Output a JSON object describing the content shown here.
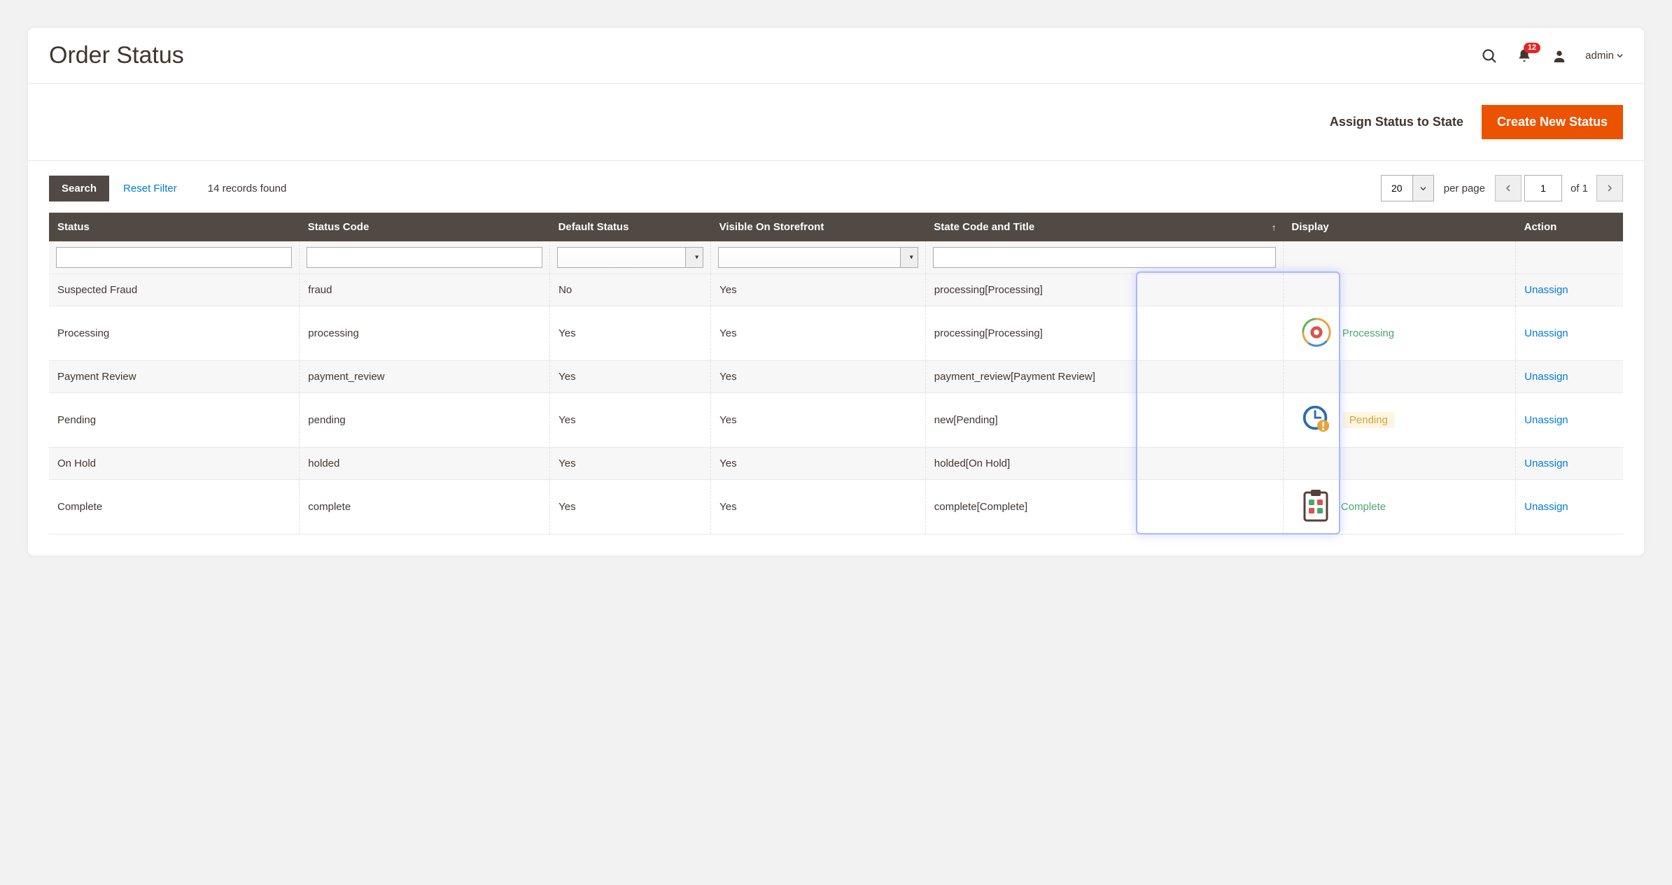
{
  "header": {
    "title": "Order Status",
    "notification_count": "12",
    "user_label": "admin"
  },
  "actionbar": {
    "assign_label": "Assign Status to State",
    "create_label": "Create New Status"
  },
  "toolbar": {
    "search_label": "Search",
    "reset_label": "Reset Filter",
    "records_found": "14 records found",
    "page_size": "20",
    "per_page_label": "per page",
    "page_current": "1",
    "page_of": "of 1"
  },
  "columns": {
    "status": "Status",
    "code": "Status Code",
    "default": "Default Status",
    "visible": "Visible On Storefront",
    "state": "State Code and Title",
    "display": "Display",
    "action": "Action"
  },
  "rows": [
    {
      "status": "Suspected Fraud",
      "code": "fraud",
      "default": "No",
      "visible": "Yes",
      "state": "processing[Processing]",
      "display": "",
      "action": "Unassign"
    },
    {
      "status": "Processing",
      "code": "processing",
      "default": "Yes",
      "visible": "Yes",
      "state": "processing[Processing]",
      "display": "Processing",
      "action": "Unassign"
    },
    {
      "status": "Payment Review",
      "code": "payment_review",
      "default": "Yes",
      "visible": "Yes",
      "state": "payment_review[Payment Review]",
      "display": "",
      "action": "Unassign"
    },
    {
      "status": "Pending",
      "code": "pending",
      "default": "Yes",
      "visible": "Yes",
      "state": "new[Pending]",
      "display": "Pending",
      "action": "Unassign"
    },
    {
      "status": "On Hold",
      "code": "holded",
      "default": "Yes",
      "visible": "Yes",
      "state": "holded[On Hold]",
      "display": "",
      "action": "Unassign"
    },
    {
      "status": "Complete",
      "code": "complete",
      "default": "Yes",
      "visible": "Yes",
      "state": "complete[Complete]",
      "display": "Complete",
      "action": "Unassign"
    }
  ]
}
